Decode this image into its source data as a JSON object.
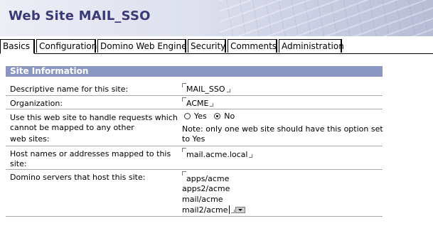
{
  "header": {
    "title": "Web Site MAIL_SSO"
  },
  "tabs": [
    {
      "label": "Basics",
      "active": true
    },
    {
      "label": "Configuration",
      "active": false
    },
    {
      "label": "Domino Web Engine",
      "active": false
    },
    {
      "label": "Security",
      "active": false
    },
    {
      "label": "Comments",
      "active": false
    },
    {
      "label": "Administration",
      "active": false
    }
  ],
  "section": {
    "title": "Site Information"
  },
  "fields": {
    "descriptive_name": {
      "label": "Descriptive name for this site:",
      "value": "MAIL_SSO"
    },
    "organization": {
      "label": "Organization:",
      "value": "ACME"
    },
    "default_site": {
      "label_line1": "Use this web site to handle requests which",
      "label_line2": "cannot be mapped to any other",
      "label_line3": "web sites:",
      "options": [
        "Yes",
        "No"
      ],
      "selected": "No",
      "note_line1": "Note: only one web site should have this option set",
      "note_line2": "to Yes"
    },
    "host_names": {
      "label_line1": "Host names or addresses mapped to this",
      "label_line2": "site:",
      "value": "mail.acme.local"
    },
    "domino_servers": {
      "label": "Domino servers that host this site:",
      "values": [
        "apps/acme",
        "apps2/acme",
        "mail/acme",
        "mail2/acme"
      ]
    }
  },
  "colors": {
    "banner_title": "#3a3a78",
    "section_bar": "#8b97c1",
    "row_divider": "#a8a8a8"
  }
}
